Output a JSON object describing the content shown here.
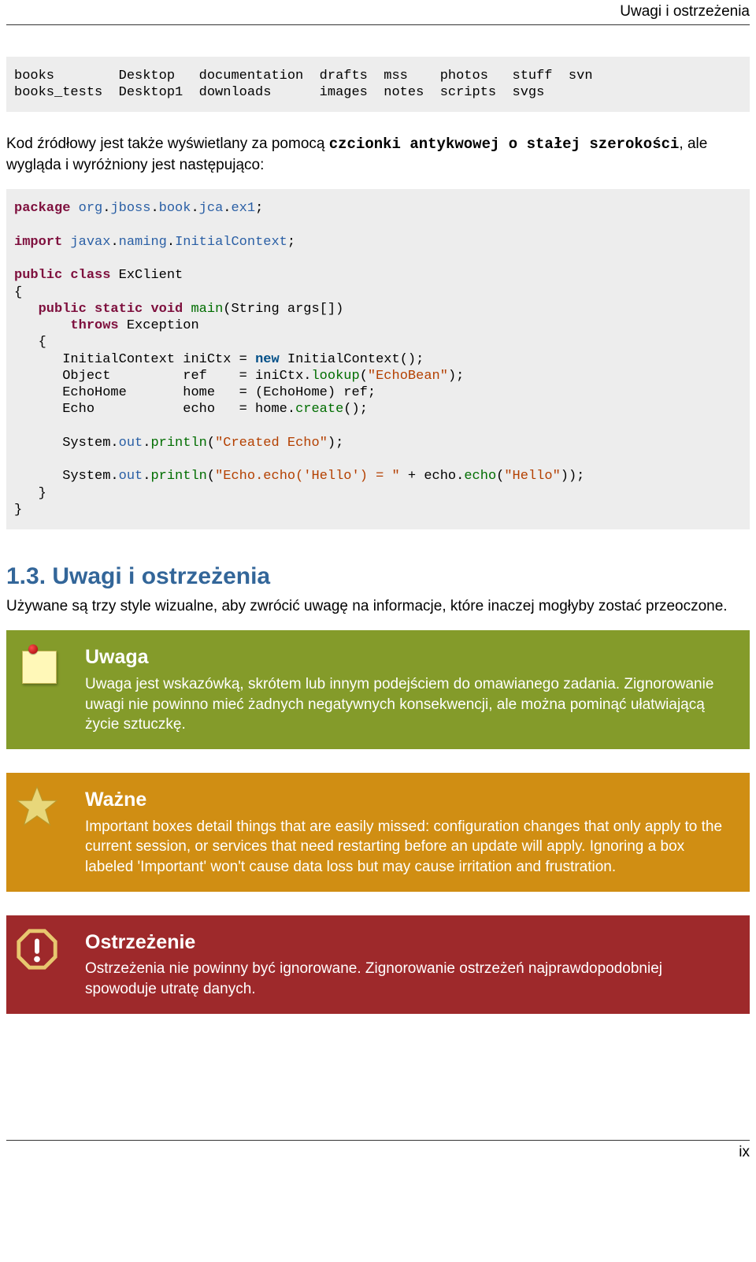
{
  "header": {
    "right": "Uwagi i ostrzeżenia"
  },
  "footer": {
    "right": "ix"
  },
  "ls_block": "books        Desktop   documentation  drafts  mss    photos   stuff  svn\nbooks_tests  Desktop1  downloads      images  notes  scripts  svgs",
  "para_source": {
    "pre": "Kod źródłowy jest także wyświetlany za pomocą ",
    "bold": "czcionki antykwowej o stałej szerokości",
    "post": ", ale wygląda i wyróżniony jest następująco:"
  },
  "code": {
    "l1a": "package",
    "l1b": "org",
    "l1c": "jboss",
    "l1d": "book",
    "l1e": "jca",
    "l1f": "ex1",
    "l2a": "import",
    "l2b": "javax",
    "l2c": "naming",
    "l2d": "InitialContext",
    "l3a": "public",
    "l3b": "class",
    "l3c": "ExClient",
    "l4a": "public",
    "l4b": "static",
    "l4c": "void",
    "l4d": "main",
    "l4e": "(String args[])",
    "l5a": "throws",
    "l5b": "Exception",
    "l6a": "InitialContext iniCtx = ",
    "l6b": "new",
    "l6c": " InitialContext();",
    "l7a": "Object         ref    = iniCtx.",
    "l7b": "lookup",
    "l7c": "(",
    "l7d": "\"EchoBean\"",
    "l7e": ");",
    "l8": "EchoHome       home   = (EchoHome) ref;",
    "l9a": "Echo           echo   = home.",
    "l9b": "create",
    "l9c": "();",
    "l10a": "System.",
    "l10b": "out",
    "l10c": ".",
    "l10d": "println",
    "l10e": "(",
    "l10f": "\"Created Echo\"",
    "l10g": ");",
    "l11a": "System.",
    "l11b": "out",
    "l11c": ".",
    "l11d": "println",
    "l11e": "(",
    "l11f": "\"Echo.echo('Hello') = \"",
    "l11g": " + echo.",
    "l11h": "echo",
    "l11i": "(",
    "l11j": "\"Hello\"",
    "l11k": "));"
  },
  "section": {
    "title": "1.3. Uwagi i ostrzeżenia",
    "intro": "Używane są trzy style wizualne, aby zwrócić uwagę na informacje, które inaczej mogłyby zostać przeoczone."
  },
  "note": {
    "title": "Uwaga",
    "body": "Uwaga jest wskazówką, skrótem lub innym podejściem do omawianego zadania. Zignorowanie uwagi nie powinno mieć żadnych negatywnych konsekwencji, ale można pominąć ułatwiającą życie sztuczkę."
  },
  "important": {
    "title": "Ważne",
    "body": "Important boxes detail things that are easily missed: configuration changes that only apply to the current session, or services that need restarting before an update will apply. Ignoring a box labeled 'Important' won't cause data loss but may cause irritation and frustration."
  },
  "warning": {
    "title": "Ostrzeżenie",
    "body": "Ostrzeżenia nie powinny być ignorowane. Zignorowanie ostrzeżeń najprawdopodobniej spowoduje utratę danych."
  }
}
